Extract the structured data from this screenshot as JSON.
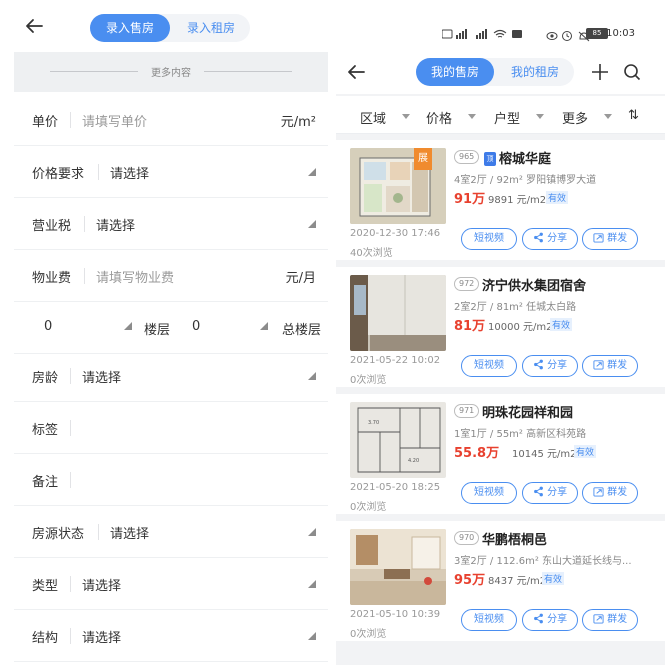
{
  "left": {
    "tabs": {
      "active": "录入售房",
      "inactive": "录入租房"
    },
    "more": "更多内容",
    "unit_price": {
      "label": "单价",
      "placeholder": "请填写单价",
      "unit": "元/m²"
    },
    "price_req": {
      "label": "价格要求",
      "value": "请选择"
    },
    "business_tax": {
      "label": "营业税",
      "value": "请选择"
    },
    "property_fee": {
      "label": "物业费",
      "placeholder": "请填写物业费",
      "unit": "元/月"
    },
    "floors": {
      "floor_value": "0",
      "floor_label": "楼层",
      "total_value": "0",
      "total_label": "总楼层"
    },
    "age": {
      "label": "房龄",
      "value": "请选择"
    },
    "tags": {
      "label": "标签"
    },
    "remark": {
      "label": "备注"
    },
    "source_status": {
      "label": "房源状态",
      "value": "请选择"
    },
    "type": {
      "label": "类型",
      "value": "请选择"
    },
    "structure": {
      "label": "结构",
      "value": "请选择"
    }
  },
  "right": {
    "status_time": "10:03",
    "battery": "85",
    "tabs": {
      "active": "我的售房",
      "inactive": "我的租房"
    },
    "filters": [
      "区域",
      "价格",
      "户型",
      "更多",
      "⇅"
    ],
    "buttons": {
      "video": "短视频",
      "share": "分享",
      "group": "群发"
    },
    "listings": [
      {
        "id": "965",
        "badge": "展",
        "tag": "顶",
        "title": "榕城华庭",
        "specs": "4室2厅 / 92m²  罗阳镇博罗大道",
        "price": "91万",
        "unit_price": "9891 元/m2",
        "valid": "有效",
        "date": "2020-12-30 17:46",
        "views": "40次浏览"
      },
      {
        "id": "972",
        "title": "济宁供水集团宿舍",
        "specs": "2室2厅 / 81m²  任城太白路",
        "price": "81万",
        "unit_price": "10000 元/m2",
        "valid": "有效",
        "date": "2021-05-22 10:02",
        "views": "0次浏览"
      },
      {
        "id": "971",
        "title": "明珠花园祥和园",
        "specs": "1室1厅 / 55m²  高新区科苑路",
        "price": "55.8万",
        "unit_price": "10145 元/m2",
        "valid": "有效",
        "date": "2021-05-20 18:25",
        "views": "0次浏览"
      },
      {
        "id": "970",
        "title": "华鹏梧桐邑",
        "specs": "3室2厅 / 112.6m²  东山大道延长线与...",
        "price": "95万",
        "unit_price": "8437 元/m2",
        "valid": "有效",
        "date": "2021-05-10 10:39",
        "views": "0次浏览"
      }
    ]
  }
}
